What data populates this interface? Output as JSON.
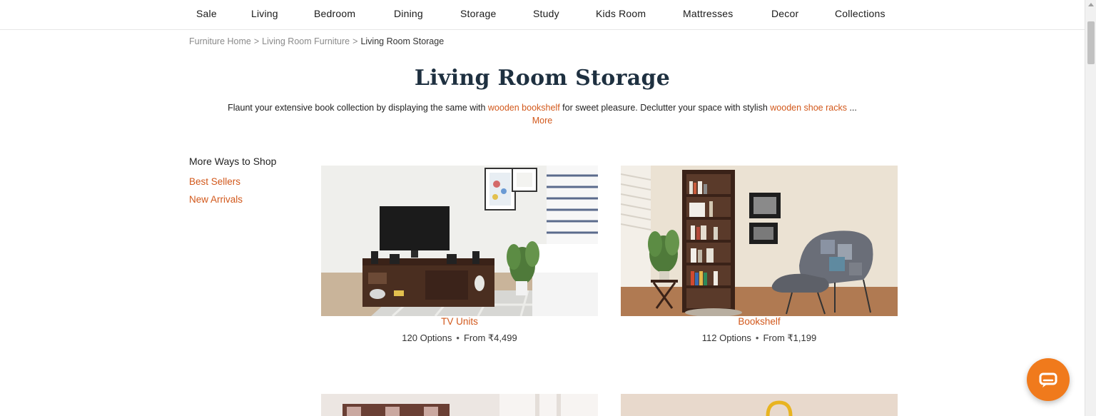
{
  "nav": {
    "items": [
      "Sale",
      "Living",
      "Bedroom",
      "Dining",
      "Storage",
      "Study",
      "Kids Room",
      "Mattresses",
      "Decor",
      "Collections"
    ]
  },
  "breadcrumb": {
    "home": "Furniture Home",
    "parent": "Living Room Furniture",
    "current": "Living Room Storage",
    "separator": ">"
  },
  "page": {
    "title": "Living Room Storage",
    "intro_part1": "Flaunt your extensive book collection by displaying the same with ",
    "intro_link1": "wooden bookshelf",
    "intro_part2": " for sweet pleasure. Declutter your space with stylish ",
    "intro_link2": "wooden shoe racks",
    "intro_ellipsis": " ...",
    "more_label": "More"
  },
  "sidebar": {
    "title": "More Ways to Shop",
    "links": [
      "Best Sellers",
      "New Arrivals"
    ]
  },
  "products": [
    {
      "name": "TV Units",
      "options": "120 Options",
      "price": "From ₹4,499"
    },
    {
      "name": "Bookshelf",
      "options": "112 Options",
      "price": "From ₹1,199"
    }
  ],
  "colors": {
    "accent": "#d2581b",
    "chat_button": "#f07a1c",
    "title": "#1e3040"
  },
  "icons": {
    "chat": "chat-bubble-icon"
  }
}
